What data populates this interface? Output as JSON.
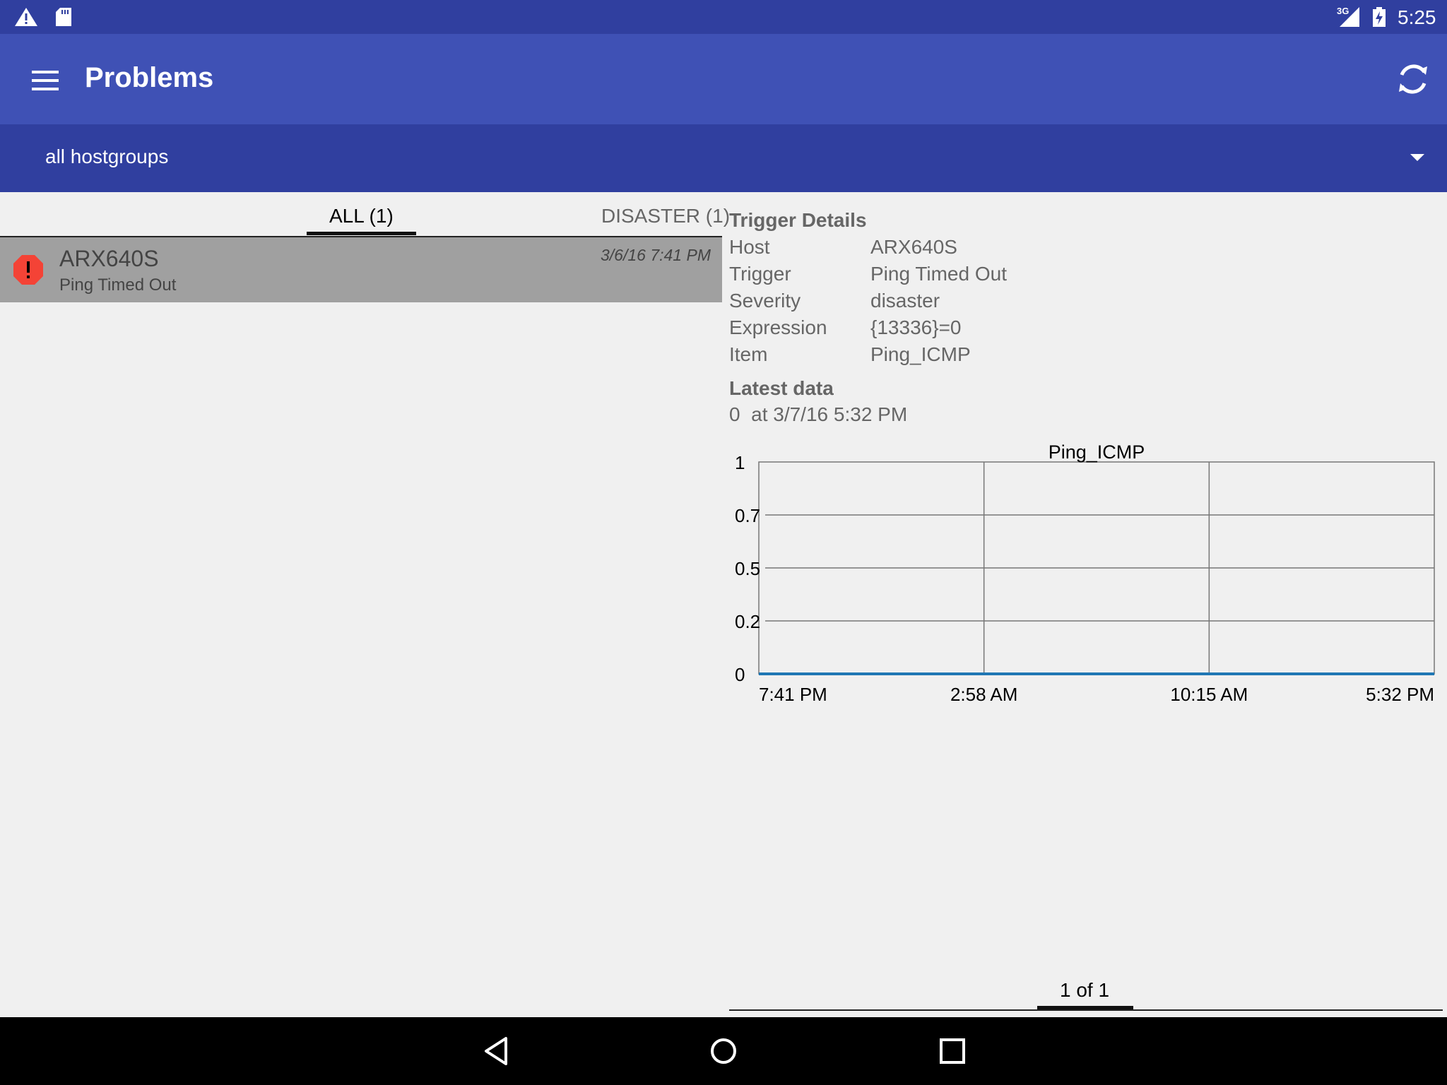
{
  "status_bar": {
    "network_label": "3G",
    "clock": "5:25",
    "icons": [
      "warning-icon",
      "sd-card-icon",
      "signal-icon",
      "battery-charging-icon"
    ]
  },
  "app_bar": {
    "title": "Problems",
    "menu_icon": "hamburger-menu-icon",
    "refresh_icon": "refresh-icon"
  },
  "hostgroup_spinner": {
    "selected": "all hostgroups"
  },
  "tabs": [
    {
      "label": "ALL (1)",
      "selected": true
    },
    {
      "label": "DISASTER (1)",
      "selected": false
    }
  ],
  "problems": [
    {
      "host": "ARX640S",
      "trigger": "Ping Timed Out",
      "time": "3/6/16 7:41 PM",
      "severity_color": "#f44336"
    }
  ],
  "details": {
    "title": "Trigger Details",
    "rows": [
      {
        "label": "Host",
        "value": "ARX640S"
      },
      {
        "label": "Trigger",
        "value": "Ping Timed Out"
      },
      {
        "label": "Severity",
        "value": "disaster"
      },
      {
        "label": "Expression",
        "value": "{13336}=0"
      },
      {
        "label": "Item",
        "value": "Ping_ICMP"
      }
    ],
    "latest_title": "Latest data",
    "latest_value": "0  at 3/7/16 5:32 PM"
  },
  "chart_data": {
    "type": "line",
    "title": "Ping_ICMP",
    "x_ticks": [
      "7:41 PM",
      "2:58 AM",
      "10:15 AM",
      "5:32 PM"
    ],
    "y_ticks": [
      "0",
      "0.2",
      "0.5",
      "0.7",
      "1"
    ],
    "ylim": [
      0,
      1
    ],
    "grid": true,
    "series": [
      {
        "color": "#1f77b4",
        "x": [
          0,
          1
        ],
        "values": [
          0,
          0
        ]
      }
    ]
  },
  "pager": {
    "text": "1 of 1"
  }
}
